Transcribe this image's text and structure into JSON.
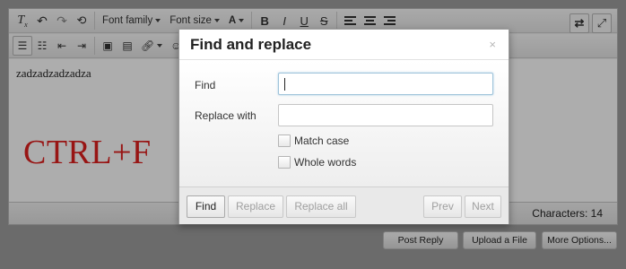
{
  "toolbar": {
    "font_family": "Font family",
    "font_size": "Font size",
    "text_color": "A",
    "bold": "B",
    "italic": "I",
    "underline": "U",
    "strikethrough": "S"
  },
  "editor": {
    "content_text": "zadzadzadzadza",
    "hint_text": "CTRL+F",
    "character_count": "Characters: 14"
  },
  "page_buttons": {
    "post_reply": "Post Reply",
    "upload_file": "Upload a File",
    "more_options": "More Options..."
  },
  "dialog": {
    "title": "Find and replace",
    "close": "×",
    "find_label": "Find",
    "find_value": "",
    "replace_label": "Replace with",
    "replace_value": "",
    "match_case_label": "Match case",
    "whole_words_label": "Whole words",
    "buttons": {
      "find": "Find",
      "replace": "Replace",
      "replace_all": "Replace all",
      "prev": "Prev",
      "next": "Next"
    }
  },
  "icons": {
    "clear_format": "clear-format-icon",
    "undo": "undo-icon",
    "redo": "redo-icon",
    "history": "history-icon",
    "align_left": "align-left-icon",
    "align_center": "align-center-icon",
    "align_right": "align-right-icon",
    "bullet_list": "bullet-list-icon",
    "numbered_list": "numbered-list-icon",
    "outdent": "outdent-icon",
    "indent": "indent-icon",
    "image": "image-icon",
    "media": "media-icon",
    "link": "link-icon",
    "emoticon": "emoticon-icon",
    "toggle_editor": "toggle-editor-icon",
    "fullscreen": "fullscreen-icon"
  },
  "colors": {
    "hint_text": "#e0201e",
    "dialog_background": "#ffffff",
    "overlay": "rgba(0,0,0,0.32)"
  }
}
